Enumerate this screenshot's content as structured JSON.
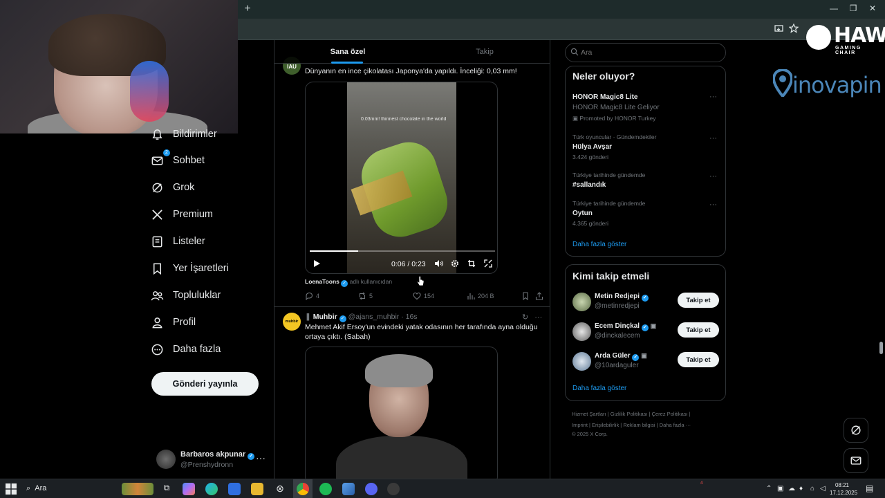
{
  "browser": {
    "new_tab_glyph": "+",
    "window_controls": [
      "—",
      "❐",
      "✕"
    ]
  },
  "brand_overlays": {
    "hawk_name": "HAWK",
    "hawk_tagline": "GAMING CHAIR",
    "inova_name": "inovapin"
  },
  "nav": {
    "items": [
      {
        "label": "Bildirimler",
        "icon": "bell-icon"
      },
      {
        "label": "Sohbet",
        "icon": "mail-icon",
        "badge": "2"
      },
      {
        "label": "Grok",
        "icon": "grok-icon"
      },
      {
        "label": "Premium",
        "icon": "x-logo-icon"
      },
      {
        "label": "Listeler",
        "icon": "list-icon"
      },
      {
        "label": "Yer İşaretleri",
        "icon": "bookmark-icon"
      },
      {
        "label": "Topluluklar",
        "icon": "people-icon"
      },
      {
        "label": "Profil",
        "icon": "person-icon"
      },
      {
        "label": "Daha fazla",
        "icon": "more-circle-icon"
      }
    ],
    "post_button": "Gönderi yayınla"
  },
  "account": {
    "name": "Barbaros akpunar",
    "handle": "@Prenshydronn",
    "more": "···"
  },
  "timeline": {
    "tabs": [
      {
        "label": "Sana özel"
      },
      {
        "label": "Takip"
      }
    ],
    "post1": {
      "avatar_text": "IAU",
      "text": "Dünyanın en ince çikolatası Japonya'da yapıldı. İnceliği: 0,03 mm!",
      "video_caption": "0.03mm! thinnest chocolate in the world",
      "video_time": "0:06 / 0:23",
      "video_progress": 0.26,
      "credit_name": "LoenaToons",
      "credit_sub": "adlı kullanıcıdan",
      "replies": "4",
      "reposts": "5",
      "likes": "154",
      "views": "204 B"
    },
    "post2": {
      "avatar_text": "muhbir",
      "name": "Muhbir",
      "handle": "@ajans_muhbir",
      "time": "· 16s",
      "text_line1": "Mehmet Akif Ersoy'un evindeki yatak odasının her tarafında ayna olduğu",
      "text_line2": "ortaya çıktı. (Sabah)",
      "more": "···"
    }
  },
  "sidebar": {
    "search_placeholder": "Ara",
    "trends_title": "Neler oluyor?",
    "trends": [
      {
        "meta": "",
        "title": "HONOR Magic8 Lite",
        "sub": "HONOR Magic8 Lite Geliyor",
        "extra": "Promoted by HONOR Turkey"
      },
      {
        "meta": "Türk oyuncular · Gündemdekiler",
        "title": "Hülya Avşar",
        "sub": "3.424 gönderi"
      },
      {
        "meta": "Türkiye tarihinde gündemde",
        "title": "#sallandık",
        "sub": ""
      },
      {
        "meta": "Türkiye tarihinde gündemde",
        "title": "Oytun",
        "sub": "4.365 gönderi"
      }
    ],
    "trends_more": "Daha fazla göster",
    "who_title": "Kimi takip etmeli",
    "who": [
      {
        "name": "Metin Redjepi",
        "handle": "@metinredjepi",
        "button": "Takip et"
      },
      {
        "name": "Ecem Dinçkal",
        "handle": "@dinckalecem",
        "button": "Takip et"
      },
      {
        "name": "Arda Güler",
        "handle": "@10ardaguler",
        "button": "Takip et"
      }
    ],
    "who_more": "Daha fazla göster",
    "footer_line1": "Hizmet Şartları  |  Gizlilik Politikası  |  Çerez Politikası  |",
    "footer_line2": "Imprint  |  Erişilebilirlik  |  Reklam bilgisi  |  Daha fazla ···",
    "footer_line3": "© 2025 X Corp."
  },
  "taskbar": {
    "search_label": "Ara",
    "clock_time": "08:21",
    "clock_date": "17.12.2025",
    "notification_count": "4"
  },
  "colors": {
    "accent": "#1d9bf0",
    "background": "#000000",
    "border": "#2f3336",
    "muted_text": "#71767b"
  }
}
